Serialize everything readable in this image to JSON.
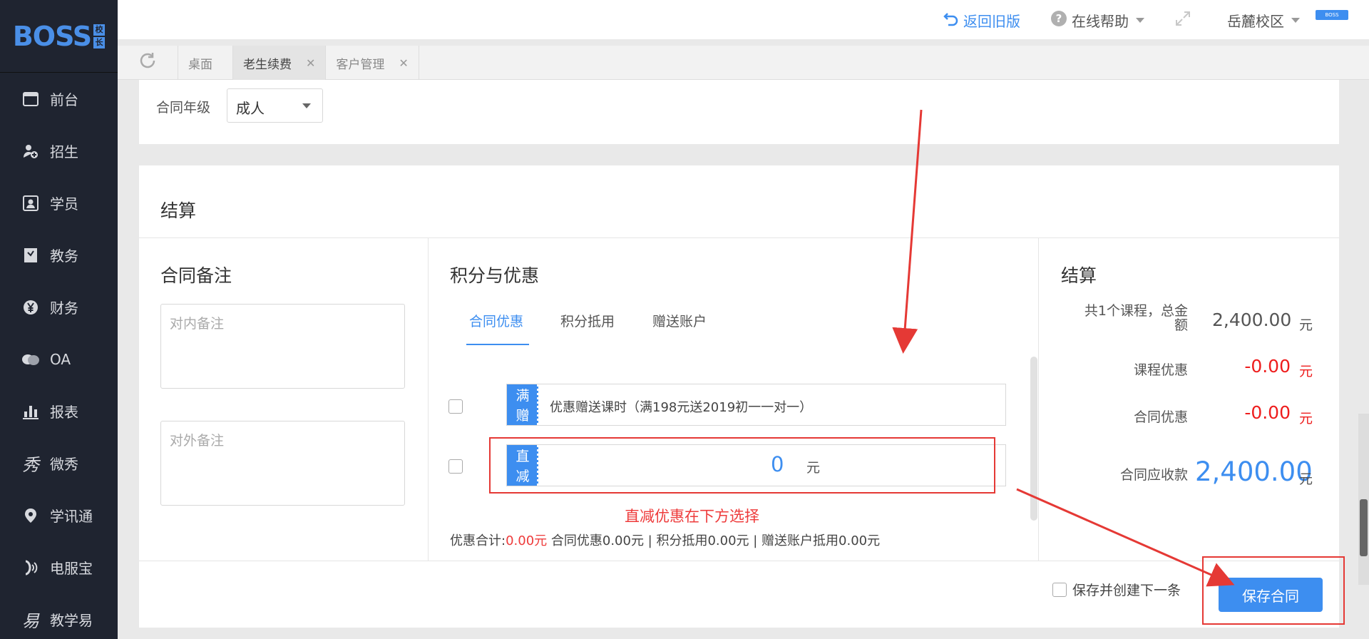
{
  "logo": {
    "text": "BOSS",
    "badge_top": "校",
    "badge_bottom": "长"
  },
  "sidebar": {
    "items": [
      {
        "label": "前台",
        "icon": "calendar-icon"
      },
      {
        "label": "招生",
        "icon": "user-add-icon"
      },
      {
        "label": "学员",
        "icon": "student-card-icon"
      },
      {
        "label": "教务",
        "icon": "book-icon"
      },
      {
        "label": "财务",
        "icon": "yen-icon"
      },
      {
        "label": "OA",
        "icon": "chat-bubbles-icon"
      },
      {
        "label": "报表",
        "icon": "bar-chart-icon"
      },
      {
        "label": "微秀",
        "icon": "wei-xiu-icon"
      },
      {
        "label": "学讯通",
        "icon": "location-pin-icon"
      },
      {
        "label": "电服宝",
        "icon": "phone-service-icon"
      },
      {
        "label": "教学易",
        "icon": "teach-easy-icon"
      }
    ]
  },
  "header": {
    "back_label": "返回旧版",
    "help_label": "在线帮助",
    "campus_label": "岳麓校区",
    "mini_logo_text": "BOSS"
  },
  "tabs": [
    {
      "label": "桌面"
    },
    {
      "label": "老生续费"
    },
    {
      "label": "客户管理"
    }
  ],
  "contract_grade": {
    "label": "合同年级",
    "value": "成人"
  },
  "settlement": {
    "title": "结算",
    "remarks": {
      "title": "合同备注",
      "internal_placeholder": "对内备注",
      "external_placeholder": "对外备注"
    },
    "discounts": {
      "title": "积分与优惠",
      "tabs": [
        "合同优惠",
        "积分抵用",
        "赠送账户"
      ],
      "promo1": {
        "tag_line1": "满",
        "tag_line2": "赠",
        "text": "优惠赠送课时（满198元送2019初一一对一）"
      },
      "promo2": {
        "tag_line1": "直",
        "tag_line2": "减",
        "amount": "0",
        "unit": "元"
      },
      "summary_prefix": "优惠合计:",
      "summary_total": "0.00元",
      "summary_rest": " 合同优惠0.00元 | 积分抵用0.00元 | 赠送账户抵用0.00元"
    },
    "totals": {
      "title": "结算",
      "course_total_label_line1": "共1个课程，总金",
      "course_total_label_line2": "额",
      "course_total_value": "2,400.00",
      "course_discount_label": "课程优惠",
      "course_discount_value": "-0.00",
      "contract_discount_label": "合同优惠",
      "contract_discount_value": "-0.00",
      "receivable_label": "合同应收款",
      "receivable_value": "2,400.00",
      "unit": "元"
    },
    "save_next_label": "保存并创建下一条",
    "save_button_label": "保存合同"
  },
  "annotation": {
    "text": "直减优惠在下方选择"
  },
  "colors": {
    "accent": "#3d8ef0",
    "danger": "#ee1d1d",
    "sidebar_bg": "#1f2430",
    "annotation_red": "#e53935"
  }
}
